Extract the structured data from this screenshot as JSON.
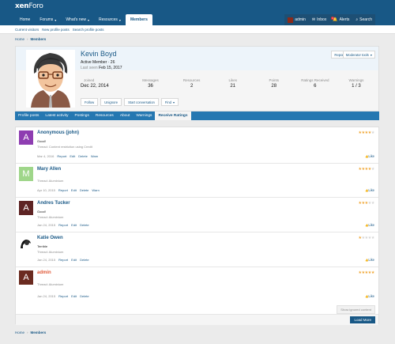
{
  "header": {
    "logo_main": "xen",
    "logo_x": "Foro"
  },
  "nav": {
    "items": [
      {
        "label": "Home"
      },
      {
        "label": "Forums",
        "caret": "▾"
      },
      {
        "label": "What's new",
        "caret": "▾"
      },
      {
        "label": "Resources",
        "caret": "▾"
      },
      {
        "label": "Members"
      }
    ]
  },
  "user": {
    "name": "admin",
    "inbox": "Inbox",
    "alerts": "Alerts",
    "search": "Search",
    "alerts_badge": "1"
  },
  "subnav": {
    "items": [
      "Current visitors",
      "New profile posts",
      "Search profile posts"
    ]
  },
  "breadcrumb": {
    "home": "Home",
    "sep": "›",
    "current": "Members"
  },
  "profile": {
    "name": "Kevin Boyd",
    "title": "Active Member · 26",
    "last_seen_label": "Last seen",
    "last_seen": "Feb 15, 2017",
    "report": "Report",
    "mod_tools": "Moderator tools",
    "stats": [
      {
        "label": "Joined",
        "value": "Dec 22, 2014"
      },
      {
        "label": "Messages",
        "value": "36"
      },
      {
        "label": "Resources",
        "value": "2"
      },
      {
        "label": "Likes",
        "value": "21"
      },
      {
        "label": "Points",
        "value": "28"
      },
      {
        "label": "Ratings Received",
        "value": "6"
      },
      {
        "label": "Warnings",
        "value": "1 / 3"
      }
    ],
    "actions": {
      "follow": "Follow",
      "unignore": "Unignore",
      "start_conversation": "Start conversation",
      "find": "Find"
    }
  },
  "tabs": [
    {
      "label": "Profile posts"
    },
    {
      "label": "Latest activity"
    },
    {
      "label": "Postings"
    },
    {
      "label": "Resources"
    },
    {
      "label": "About"
    },
    {
      "label": "Warnings"
    },
    {
      "label": "Receive Ratings"
    }
  ],
  "ratings": [
    {
      "name": "Anonymous (john)",
      "initial": "A",
      "color": "#8e3db1",
      "line1": "Good!",
      "line2": "Thread: Content restriction using Credit",
      "date": "Mar 4, 2016",
      "stars": 4,
      "actions": [
        "Report",
        "Edit",
        "Delete",
        "Warn"
      ],
      "like": "Like",
      "is_admin": false
    },
    {
      "name": "Mary Allen",
      "initial": "M",
      "color": "#9fd68a",
      "line1": "",
      "line2": "Thread: Aluminium",
      "date": "Apr 10, 2015",
      "stars": 4,
      "actions": [
        "Report",
        "Edit",
        "Delete",
        "Warn"
      ],
      "like": "Like",
      "is_admin": false
    },
    {
      "name": "Andres Tucker",
      "initial": "A",
      "color": "#5e2424",
      "line1": "Good!",
      "line2": "Thread: Aluminium",
      "date": "Jan 24, 2015",
      "stars": 3,
      "actions": [
        "Report",
        "Edit",
        "Delete"
      ],
      "like": "Like",
      "is_admin": false
    },
    {
      "name": "Katie Owen",
      "initial": "",
      "color": "#ffffff",
      "line1": "Terrible",
      "line2": "Thread: Aluminium",
      "date": "Jan 24, 2015",
      "stars": 1,
      "actions": [
        "Report",
        "Edit",
        "Delete"
      ],
      "like": "Like",
      "is_admin": false
    },
    {
      "name": "admin",
      "initial": "A",
      "color": "#6b2b20",
      "line1": "",
      "line2": "Thread: Aluminium",
      "date": "Jan 24, 2015",
      "stars": 5,
      "actions": [
        "Report",
        "Edit",
        "Delete"
      ],
      "like": "Like",
      "is_admin": true
    }
  ],
  "list_footer": {
    "show_ignored": "Show ignored content",
    "load_more": "Load More"
  },
  "colors": {
    "brand": "#185886",
    "tab_bar": "#2577b1",
    "star": "#f0a531",
    "admin_name": "#e05a3a"
  }
}
